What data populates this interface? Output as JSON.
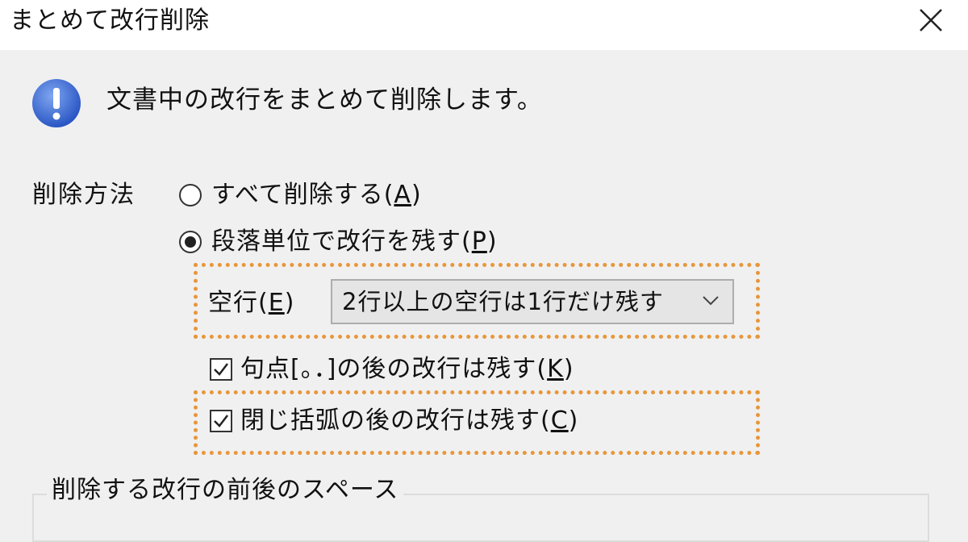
{
  "window": {
    "title": "まとめて改行削除",
    "close_icon": "close-icon"
  },
  "message": {
    "icon": "info-exclamation-icon",
    "text": "文書中の改行をまとめて削除します。"
  },
  "method": {
    "label": "削除方法",
    "options": [
      {
        "text": "すべて削除する(",
        "key": "A",
        "close": ")",
        "selected": false
      },
      {
        "text": "段落単位で改行を残す(",
        "key": "P",
        "close": ")",
        "selected": true
      }
    ]
  },
  "blank_line": {
    "label_text": "空行(",
    "label_key": "E",
    "label_close": ")",
    "selected_value": "2行以上の空行は1行だけ残す"
  },
  "checkboxes": [
    {
      "text": "句点[。．]の後の改行は残す(",
      "key": "K",
      "close": ")",
      "checked": true
    },
    {
      "text": "閉じ括弧の後の改行は残す(",
      "key": "C",
      "close": ")",
      "checked": true
    }
  ],
  "spaces_group": {
    "legend": "削除する改行の前後のスペース"
  },
  "colors": {
    "highlight_border": "#e8963a",
    "info_icon": "#3d6fd6"
  }
}
